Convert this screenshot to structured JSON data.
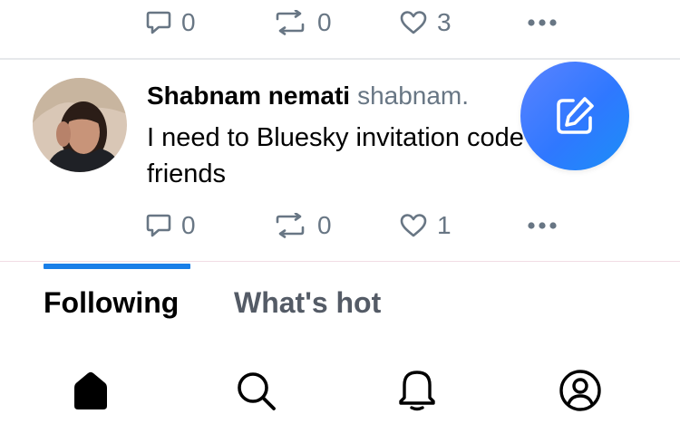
{
  "prev_post": {
    "reply_count": "0",
    "repost_count": "0",
    "like_count": "3"
  },
  "post": {
    "author_name": "Shabnam nemati",
    "author_handle": "shabnam.",
    "text": "I need to Bluesky invitation code for my friends",
    "reply_count": "0",
    "repost_count": "0",
    "like_count": "1"
  },
  "tabs": [
    {
      "label": "Following",
      "active": true
    },
    {
      "label": "What's hot",
      "active": false
    }
  ],
  "bottom_nav": {
    "items": [
      "home-icon",
      "search-icon",
      "notifications-icon",
      "profile-icon"
    ]
  },
  "colors": {
    "accent": "#1a7fe8",
    "compose": "#2f78ff",
    "muted": "#687684"
  }
}
